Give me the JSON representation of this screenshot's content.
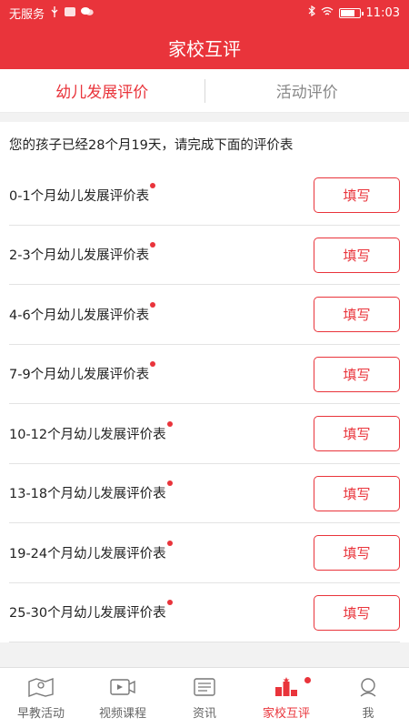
{
  "status_bar": {
    "carrier": "无服务",
    "time": "11:03",
    "icons": [
      "usb-icon",
      "huawei-icon",
      "wechat-icon",
      "bluetooth-icon",
      "wifi-icon",
      "battery-icon"
    ]
  },
  "header": {
    "title": "家校互评"
  },
  "tabs": [
    {
      "label": "幼儿发展评价",
      "active": true
    },
    {
      "label": "活动评价",
      "active": false
    }
  ],
  "intro_text": "您的孩子已经28个月19天，请完成下面的评价表",
  "forms": [
    {
      "label": "0-1个月幼儿发展评价表",
      "button": "填写"
    },
    {
      "label": "2-3个月幼儿发展评价表",
      "button": "填写"
    },
    {
      "label": "4-6个月幼儿发展评价表",
      "button": "填写"
    },
    {
      "label": "7-9个月幼儿发展评价表",
      "button": "填写"
    },
    {
      "label": "10-12个月幼儿发展评价表",
      "button": "填写"
    },
    {
      "label": "13-18个月幼儿发展评价表",
      "button": "填写"
    },
    {
      "label": "19-24个月幼儿发展评价表",
      "button": "填写"
    },
    {
      "label": "25-30个月幼儿发展评价表",
      "button": "填写"
    }
  ],
  "bottom_nav": [
    {
      "label": "早教活动",
      "icon": "map-icon",
      "active": false
    },
    {
      "label": "视频课程",
      "icon": "video-icon",
      "active": false
    },
    {
      "label": "资讯",
      "icon": "news-icon",
      "active": false
    },
    {
      "label": "家校互评",
      "icon": "podium-icon",
      "active": true
    },
    {
      "label": "我",
      "icon": "profile-icon",
      "active": false
    }
  ],
  "colors": {
    "accent": "#e9343b",
    "text": "#222222",
    "muted": "#888888"
  }
}
